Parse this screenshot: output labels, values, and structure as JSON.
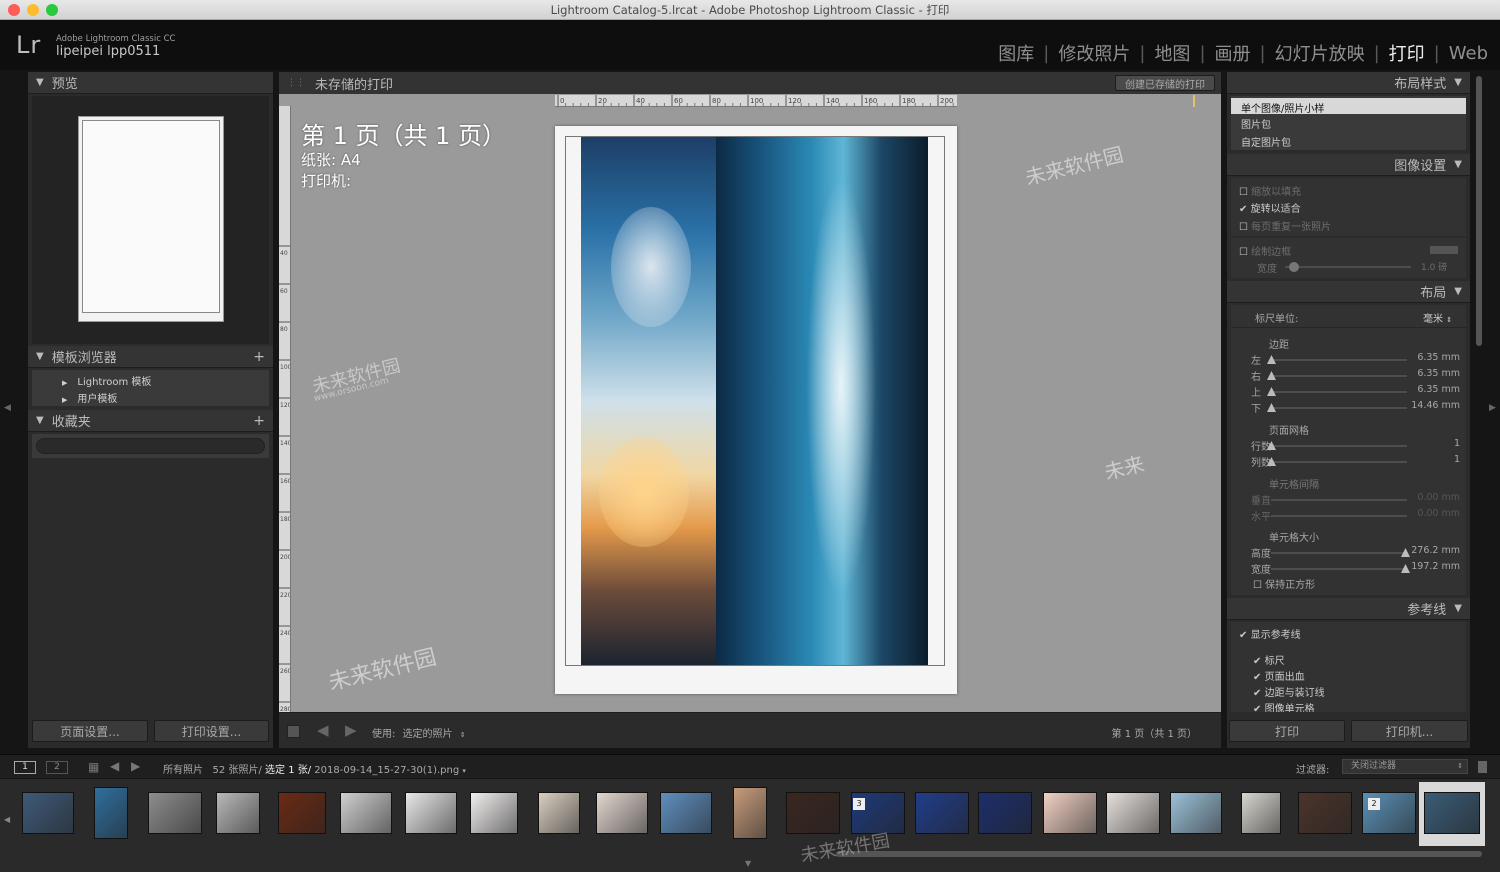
{
  "window": {
    "title": "Lightroom Catalog-5.lrcat - Adobe Photoshop Lightroom Classic - 打印"
  },
  "identity": {
    "logo": "Lr",
    "product": "Adobe Lightroom Classic CC",
    "user": "lipeipei lpp0511"
  },
  "modules": [
    {
      "label": "图库"
    },
    {
      "label": "修改照片"
    },
    {
      "label": "地图"
    },
    {
      "label": "画册"
    },
    {
      "label": "幻灯片放映"
    },
    {
      "label": "打印",
      "active": true
    },
    {
      "label": "Web"
    }
  ],
  "left": {
    "preview_title": "预览",
    "template_browser": {
      "title": "模板浏览器",
      "plus": "+",
      "items": [
        "Lightroom 模板",
        "用户模板"
      ]
    },
    "collections": {
      "title": "收藏夹",
      "plus": "+"
    },
    "page_setup": "页面设置...",
    "print_settings": "打印设置..."
  },
  "center": {
    "doc_title": "未存储的打印",
    "create_saved": "创建已存储的打印",
    "page_label": "第 1 页（共 1 页）",
    "paper": "纸张: A4",
    "printer": "打印机:",
    "ruler_ticks": [
      "0",
      "20",
      "40",
      "60",
      "80",
      "100",
      "120",
      "140",
      "160",
      "180",
      "200"
    ],
    "vruler_ticks": [
      "40",
      "60",
      "80",
      "100",
      "120",
      "140",
      "160",
      "180",
      "200",
      "220",
      "240",
      "260",
      "280"
    ],
    "toolbar": {
      "use_label": "使用:",
      "use_value": "选定的照片",
      "page_count": "第 1 页（共 1 页）"
    },
    "watermarks": [
      "未来软件园",
      "www.orsoon.com",
      "未来"
    ]
  },
  "right": {
    "layout_style": {
      "title": "布局样式",
      "items": [
        "单个图像/照片小样",
        "图片包",
        "自定图片包"
      ],
      "selected": 0
    },
    "image_settings": {
      "title": "图像设置",
      "items": [
        {
          "label": "缩放以填充",
          "checked": false
        },
        {
          "label": "旋转以适合",
          "checked": true
        },
        {
          "label": "每页重复一张照片",
          "checked": false
        }
      ],
      "border": "绘制边框",
      "width_label": "宽度",
      "width_value": "1.0 磅"
    },
    "layout": {
      "title": "布局",
      "ruler_units_label": "标尺单位:",
      "ruler_units_value": "毫米",
      "margins_title": "边距",
      "margins": [
        {
          "label": "左",
          "value": "6.35 mm",
          "pos": 0
        },
        {
          "label": "右",
          "value": "6.35 mm",
          "pos": 0
        },
        {
          "label": "上",
          "value": "6.35 mm",
          "pos": 0
        },
        {
          "label": "下",
          "value": "14.46 mm",
          "pos": 0
        }
      ],
      "grid_title": "页面网格",
      "grid": [
        {
          "label": "行数",
          "value": "1",
          "pos": 0
        },
        {
          "label": "列数",
          "value": "1",
          "pos": 0
        }
      ],
      "spacing_title": "单元格间隔",
      "spacing": [
        {
          "label": "垂直",
          "value": "0.00 mm"
        },
        {
          "label": "水平",
          "value": "0.00 mm"
        }
      ],
      "cell_title": "单元格大小",
      "cell": [
        {
          "label": "高度",
          "value": "276.2 mm",
          "pos": 1
        },
        {
          "label": "宽度",
          "value": "197.2 mm",
          "pos": 1
        }
      ],
      "keep_square": "保持正方形"
    },
    "guides": {
      "title": "参考线",
      "show": "显示参考线",
      "items": [
        "标尺",
        "页面出血",
        "边距与装订线",
        "图像单元格"
      ]
    },
    "print": "打印",
    "printer": "打印机..."
  },
  "filmstrip": {
    "tabs": [
      "1",
      "2"
    ],
    "source": "所有照片",
    "count": "52 张照片/",
    "selected": "选定 1 张/",
    "filename": "2018-09-14_15-27-30(1).png",
    "filter_label": "过滤器:",
    "filter_value": "关闭过滤器",
    "badges": [
      "3",
      "2"
    ]
  },
  "colors": {
    "accent": "#e3c06a",
    "panel": "#2b2b2b",
    "canvas": "#9a9a9a"
  }
}
